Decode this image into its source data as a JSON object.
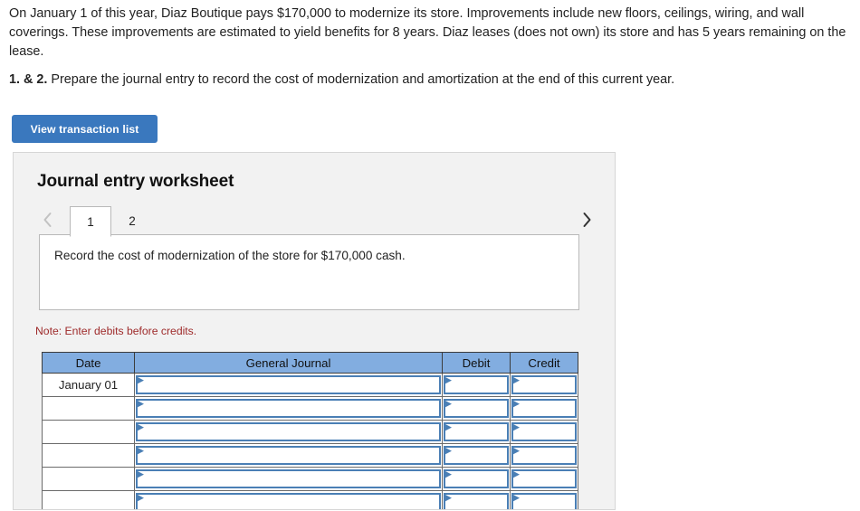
{
  "problem": {
    "statement": "On January 1 of this year, Diaz Boutique pays $170,000 to modernize its store. Improvements include new floors, ceilings, wiring, and wall coverings. These improvements are estimated to yield benefits for 8 years. Diaz leases (does not own) its store and has 5 years remaining on the lease.",
    "instruction_lead": "1. & 2.",
    "instruction_body": " Prepare the journal entry to record the cost of modernization and amortization at the end of this current year."
  },
  "toolbar": {
    "view_transaction_list_label": "View transaction list"
  },
  "worksheet": {
    "title": "Journal entry worksheet",
    "prev_icon": "chevron-left-icon",
    "next_icon": "chevron-right-icon",
    "tabs": [
      {
        "label": "1",
        "active": true
      },
      {
        "label": "2",
        "active": false
      }
    ],
    "description": "Record the cost of modernization of the store for $170,000 cash.",
    "note": "Note: Enter debits before credits.",
    "table": {
      "headers": [
        "Date",
        "General Journal",
        "Debit",
        "Credit"
      ],
      "rows": [
        {
          "date": "January 01",
          "general_journal": "",
          "debit": "",
          "credit": ""
        },
        {
          "date": "",
          "general_journal": "",
          "debit": "",
          "credit": ""
        },
        {
          "date": "",
          "general_journal": "",
          "debit": "",
          "credit": ""
        },
        {
          "date": "",
          "general_journal": "",
          "debit": "",
          "credit": ""
        },
        {
          "date": "",
          "general_journal": "",
          "debit": "",
          "credit": ""
        },
        {
          "date": "",
          "general_journal": "",
          "debit": "",
          "credit": ""
        }
      ]
    }
  },
  "colors": {
    "button_blue": "#3a78be",
    "header_blue": "#82ade0",
    "note_red": "#9e2a2a",
    "panel_gray": "#f2f2f2",
    "cell_border_blue": "#4a7fb5"
  }
}
